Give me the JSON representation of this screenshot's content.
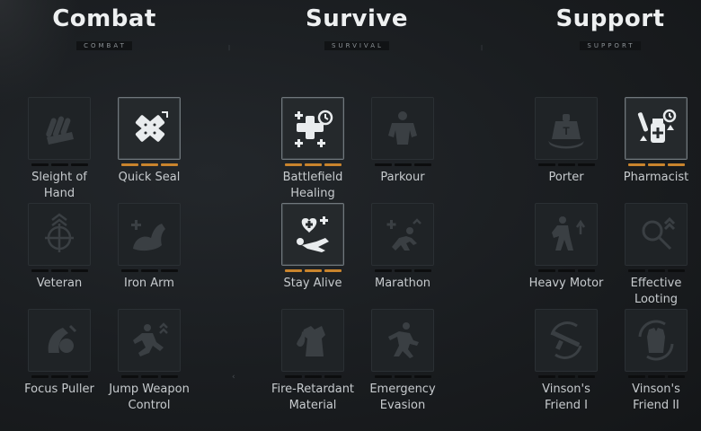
{
  "columns": [
    {
      "title": "Combat",
      "subtitle": "COMBAT"
    },
    {
      "title": "Survive",
      "subtitle": "SURVIVAL"
    },
    {
      "title": "Support",
      "subtitle": "SUPPORT"
    }
  ],
  "perks": [
    {
      "label": "Sleight of Hand",
      "icon": "bullets-hand-icon",
      "level": 0,
      "max": 3
    },
    {
      "label": "Quick Seal",
      "icon": "bandage-icon",
      "level": 3,
      "max": 3
    },
    {
      "label": "Veteran",
      "icon": "crosshair-icon",
      "level": 0,
      "max": 3
    },
    {
      "label": "Iron Arm",
      "icon": "flexed-arm-icon",
      "level": 0,
      "max": 3
    },
    {
      "label": "Focus Puller",
      "icon": "focus-icon",
      "level": 0,
      "max": 3
    },
    {
      "label": "Jump Weapon Control",
      "icon": "jump-soldier-icon",
      "level": 0,
      "max": 3
    },
    {
      "label": "Battlefield Healing",
      "icon": "medkit-timer-icon",
      "level": 3,
      "max": 3
    },
    {
      "label": "Parkour",
      "icon": "climber-icon",
      "level": 0,
      "max": 3
    },
    {
      "label": "Stay Alive",
      "icon": "downed-heart-icon",
      "level": 3,
      "max": 3
    },
    {
      "label": "Marathon",
      "icon": "runner-icon",
      "level": 0,
      "max": 3
    },
    {
      "label": "Fire-Retardant Material",
      "icon": "fireproof-vest-icon",
      "level": 0,
      "max": 3
    },
    {
      "label": "Emergency Evasion",
      "icon": "sprint-icon",
      "level": 0,
      "max": 3
    },
    {
      "label": "Porter",
      "icon": "weight-icon",
      "level": 0,
      "max": 3
    },
    {
      "label": "Pharmacist",
      "icon": "pills-icon",
      "level": 3,
      "max": 3
    },
    {
      "label": "Heavy Motor",
      "icon": "soldier-walk-icon",
      "level": 0,
      "max": 3
    },
    {
      "label": "Effective Looting",
      "icon": "magnifier-icon",
      "level": 0,
      "max": 3
    },
    {
      "label": "Vinson's Friend I",
      "icon": "rifle-cycle-icon",
      "level": 0,
      "max": 3
    },
    {
      "label": "Vinson's Friend II",
      "icon": "vest-cycle-icon",
      "level": 0,
      "max": 3
    }
  ],
  "colors": {
    "accent": "#c9842d",
    "tile": "#1f2326",
    "active_border": "#70777c"
  }
}
